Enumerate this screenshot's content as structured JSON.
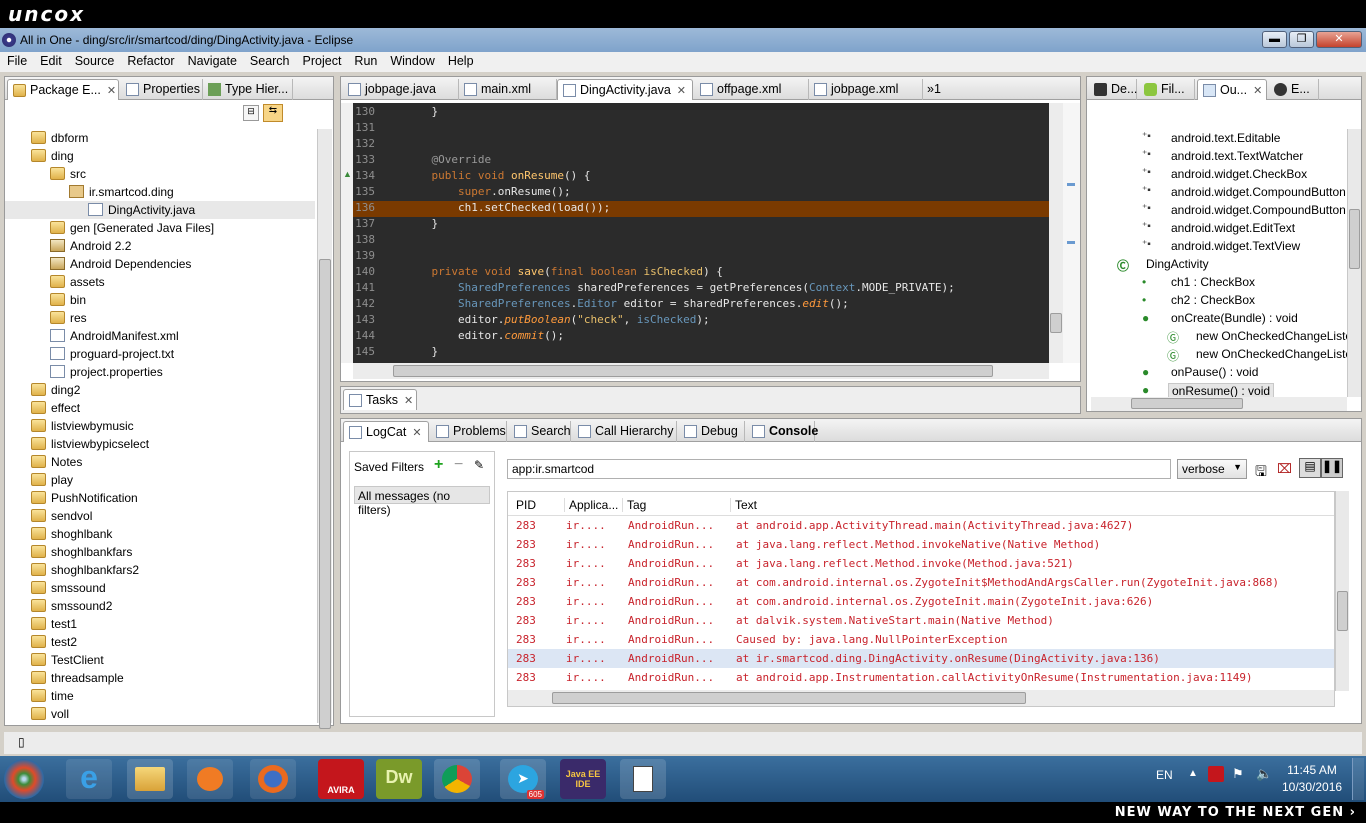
{
  "brand_top": "uncox",
  "brand_bottom": "NEW WAY TO THE NEXT GEN ›",
  "window": {
    "title": "All in One - ding/src/ir/smartcod/ding/DingActivity.java - Eclipse"
  },
  "menu": [
    "File",
    "Edit",
    "Source",
    "Refactor",
    "Navigate",
    "Search",
    "Project",
    "Run",
    "Window",
    "Help"
  ],
  "left_panel": {
    "tabs": [
      "Package E...",
      "Properties",
      "Type Hier..."
    ],
    "tree": [
      {
        "label": "dbform",
        "indent": 1,
        "icon": "folder"
      },
      {
        "label": "ding",
        "indent": 1,
        "icon": "folder"
      },
      {
        "label": "src",
        "indent": 2,
        "icon": "folder"
      },
      {
        "label": "ir.smartcod.ding",
        "indent": 3,
        "icon": "package"
      },
      {
        "label": "DingActivity.java",
        "indent": 4,
        "icon": "file"
      },
      {
        "label": "gen [Generated Java Files]",
        "indent": 2,
        "icon": "folder"
      },
      {
        "label": "Android 2.2",
        "indent": 2,
        "icon": "jar"
      },
      {
        "label": "Android Dependencies",
        "indent": 2,
        "icon": "jar"
      },
      {
        "label": "assets",
        "indent": 2,
        "icon": "folder"
      },
      {
        "label": "bin",
        "indent": 2,
        "icon": "folder"
      },
      {
        "label": "res",
        "indent": 2,
        "icon": "folder"
      },
      {
        "label": "AndroidManifest.xml",
        "indent": 2,
        "icon": "file"
      },
      {
        "label": "proguard-project.txt",
        "indent": 2,
        "icon": "file"
      },
      {
        "label": "project.properties",
        "indent": 2,
        "icon": "file"
      },
      {
        "label": "ding2",
        "indent": 1,
        "icon": "folder"
      },
      {
        "label": "effect",
        "indent": 1,
        "icon": "folder"
      },
      {
        "label": "listviewbymusic",
        "indent": 1,
        "icon": "folder"
      },
      {
        "label": "listviewbypicselect",
        "indent": 1,
        "icon": "folder"
      },
      {
        "label": "Notes",
        "indent": 1,
        "icon": "folder"
      },
      {
        "label": "play",
        "indent": 1,
        "icon": "folder"
      },
      {
        "label": "PushNotification",
        "indent": 1,
        "icon": "folder"
      },
      {
        "label": "sendvol",
        "indent": 1,
        "icon": "folder"
      },
      {
        "label": "shoghlbank",
        "indent": 1,
        "icon": "folder"
      },
      {
        "label": "shoghlbankfars",
        "indent": 1,
        "icon": "folder"
      },
      {
        "label": "shoghlbankfars2",
        "indent": 1,
        "icon": "folder"
      },
      {
        "label": "smssound",
        "indent": 1,
        "icon": "folder"
      },
      {
        "label": "smssound2",
        "indent": 1,
        "icon": "folder"
      },
      {
        "label": "test1",
        "indent": 1,
        "icon": "folder"
      },
      {
        "label": "test2",
        "indent": 1,
        "icon": "folder"
      },
      {
        "label": "TestClient",
        "indent": 1,
        "icon": "folder"
      },
      {
        "label": "threadsample",
        "indent": 1,
        "icon": "folder"
      },
      {
        "label": "time",
        "indent": 1,
        "icon": "folder"
      },
      {
        "label": "voll",
        "indent": 1,
        "icon": "folder"
      }
    ]
  },
  "editor": {
    "tabs": [
      "jobpage.java",
      "main.xml",
      "DingActivity.java",
      "offpage.xml",
      "jobpage.xml"
    ],
    "overflow": "»1",
    "lines": [
      {
        "n": "130",
        "html": "    }"
      },
      {
        "n": "131",
        "html": ""
      },
      {
        "n": "132",
        "html": ""
      },
      {
        "n": "133",
        "html": "    <span class='an'>@Override</span>"
      },
      {
        "n": "134",
        "html": "    <span class='kw'>public void</span> <span class='fn'>onResume</span>() {"
      },
      {
        "n": "135",
        "html": "        <span class='kw'>super</span>.onResume();"
      },
      {
        "n": "136",
        "html": "        ch1.setChecked(load());",
        "highlight": true
      },
      {
        "n": "137",
        "html": "    }"
      },
      {
        "n": "138",
        "html": ""
      },
      {
        "n": "139",
        "html": ""
      },
      {
        "n": "140",
        "html": "    <span class='kw'>private void</span> <span class='fn'>save</span>(<span class='kw'>final boolean</span> <span class='st'>isChecked</span>) {"
      },
      {
        "n": "141",
        "html": "        <span class='ty'>SharedPreferences</span> sharedPreferences = getPreferences(<span class='ty'>Context</span>.MODE_PRIVATE);"
      },
      {
        "n": "142",
        "html": "        <span class='ty'>SharedPreferences</span>.<span class='ty'>Editor</span> editor = sharedPreferences.<span class='it'>edit</span>();"
      },
      {
        "n": "143",
        "html": "        editor.<span class='it'>putBoolean</span>(<span class='st'>\"check\"</span>, <span class='ty'>isChecked</span>);"
      },
      {
        "n": "144",
        "html": "        editor.<span class='it'>commit</span>();"
      },
      {
        "n": "145",
        "html": "    }"
      }
    ]
  },
  "right_panel": {
    "tabs": [
      "De...",
      "Fil...",
      "Ou...",
      "E..."
    ],
    "outline": [
      {
        "label": "android.text.Editable",
        "indent": 2,
        "icon": "import"
      },
      {
        "label": "android.text.TextWatcher",
        "indent": 2,
        "icon": "import"
      },
      {
        "label": "android.widget.CheckBox",
        "indent": 2,
        "icon": "import"
      },
      {
        "label": "android.widget.CompoundButton",
        "indent": 2,
        "icon": "import"
      },
      {
        "label": "android.widget.CompoundButton",
        "indent": 2,
        "icon": "import"
      },
      {
        "label": "android.widget.EditText",
        "indent": 2,
        "icon": "import"
      },
      {
        "label": "android.widget.TextView",
        "indent": 2,
        "icon": "import"
      },
      {
        "label": "DingActivity",
        "indent": 1,
        "icon": "class"
      },
      {
        "label": "ch1 : CheckBox",
        "indent": 2,
        "icon": "field"
      },
      {
        "label": "ch2 : CheckBox",
        "indent": 2,
        "icon": "field"
      },
      {
        "label": "onCreate(Bundle) : void",
        "indent": 2,
        "icon": "method"
      },
      {
        "label": "new OnCheckedChangeListe",
        "indent": 3,
        "icon": "anon"
      },
      {
        "label": "new OnCheckedChangeListe",
        "indent": 3,
        "icon": "anon"
      },
      {
        "label": "onPause() : void",
        "indent": 2,
        "icon": "method"
      },
      {
        "label": "onResume() : void",
        "indent": 2,
        "icon": "method",
        "selected": true
      }
    ]
  },
  "tasks": {
    "tab": "Tasks"
  },
  "bottom_tabs": [
    "LogCat",
    "Problems",
    "Search",
    "Call Hierarchy",
    "Debug",
    "Console"
  ],
  "logcat": {
    "saved_filters_label": "Saved Filters",
    "filter_all": "All messages (no filters)",
    "search_value": "app:ir.smartcod",
    "level": "verbose",
    "headers": [
      "PID",
      "Applica...",
      "Tag",
      "Text"
    ],
    "rows": [
      {
        "pid": "283",
        "app": "ir....",
        "tag": "AndroidRun...",
        "text": "at android.app.ActivityThread.main(ActivityThread.java:4627)"
      },
      {
        "pid": "283",
        "app": "ir....",
        "tag": "AndroidRun...",
        "text": "at java.lang.reflect.Method.invokeNative(Native Method)"
      },
      {
        "pid": "283",
        "app": "ir....",
        "tag": "AndroidRun...",
        "text": "at java.lang.reflect.Method.invoke(Method.java:521)"
      },
      {
        "pid": "283",
        "app": "ir....",
        "tag": "AndroidRun...",
        "text": "at com.android.internal.os.ZygoteInit$MethodAndArgsCaller.run(ZygoteInit.java:868)"
      },
      {
        "pid": "283",
        "app": "ir....",
        "tag": "AndroidRun...",
        "text": "at com.android.internal.os.ZygoteInit.main(ZygoteInit.java:626)"
      },
      {
        "pid": "283",
        "app": "ir....",
        "tag": "AndroidRun...",
        "text": "at dalvik.system.NativeStart.main(Native Method)"
      },
      {
        "pid": "283",
        "app": "ir....",
        "tag": "AndroidRun...",
        "text": "Caused by: java.lang.NullPointerException"
      },
      {
        "pid": "283",
        "app": "ir....",
        "tag": "AndroidRun...",
        "text": "at ir.smartcod.ding.DingActivity.onResume(DingActivity.java:136)",
        "selected": true
      },
      {
        "pid": "283",
        "app": "ir....",
        "tag": "AndroidRun...",
        "text": "at android.app.Instrumentation.callActivityOnResume(Instrumentation.java:1149)"
      }
    ]
  },
  "tray": {
    "lang": "EN",
    "time": "11:45 AM",
    "date": "10/30/2016",
    "telegram_badge": "605"
  },
  "taskbar_icons": [
    "start-orb-icon",
    "internet-explorer-icon",
    "file-explorer-icon",
    "media-player-icon",
    "firefox-icon",
    "avira-icon",
    "dreamweaver-icon",
    "chrome-icon",
    "telegram-icon",
    "eclipse-icon",
    "notepad-icon"
  ]
}
